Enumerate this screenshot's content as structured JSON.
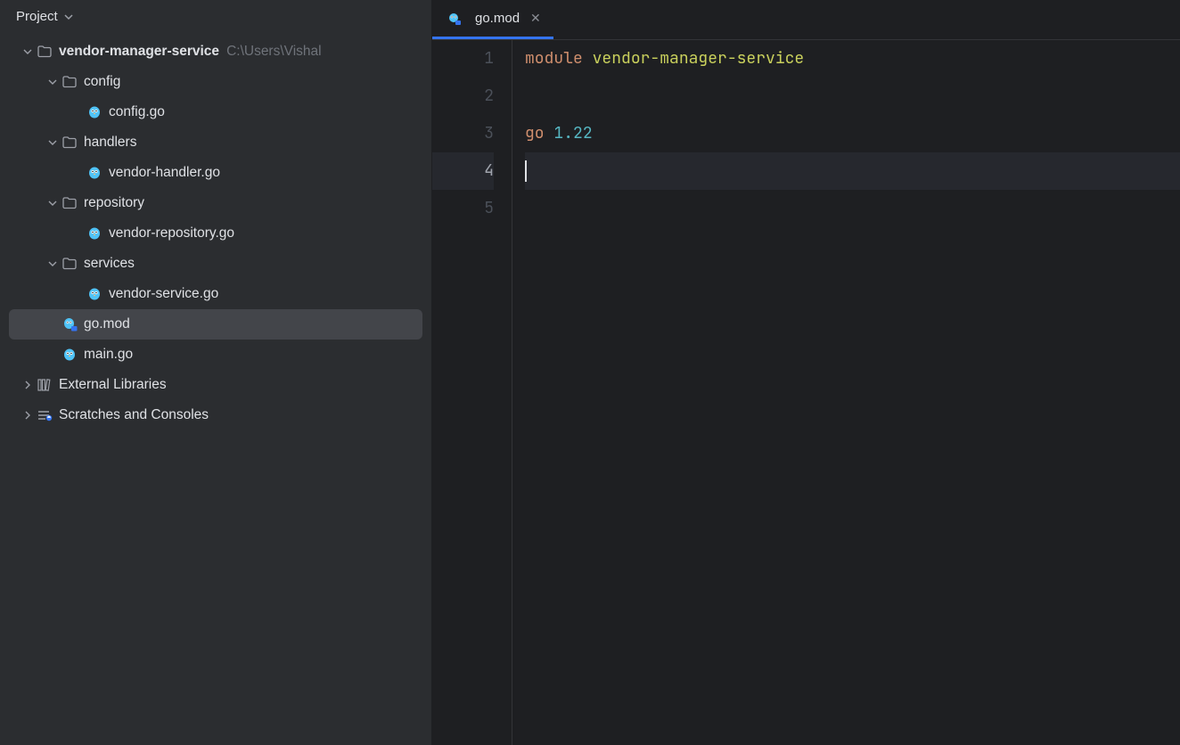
{
  "sidebar": {
    "title": "Project",
    "tree": [
      {
        "depth": 0,
        "arrow": "down",
        "icon": "folder",
        "label": "vendor-manager-service",
        "bold": true,
        "path": "C:\\Users\\Vishal"
      },
      {
        "depth": 1,
        "arrow": "down",
        "icon": "folder",
        "label": "config"
      },
      {
        "depth": 2,
        "arrow": "none",
        "icon": "gopher",
        "label": "config.go"
      },
      {
        "depth": 1,
        "arrow": "down",
        "icon": "folder",
        "label": "handlers"
      },
      {
        "depth": 2,
        "arrow": "none",
        "icon": "gopher",
        "label": "vendor-handler.go"
      },
      {
        "depth": 1,
        "arrow": "down",
        "icon": "folder",
        "label": "repository"
      },
      {
        "depth": 2,
        "arrow": "none",
        "icon": "gopher",
        "label": "vendor-repository.go"
      },
      {
        "depth": 1,
        "arrow": "down",
        "icon": "folder",
        "label": "services"
      },
      {
        "depth": 2,
        "arrow": "none",
        "icon": "gopher",
        "label": "vendor-service.go"
      },
      {
        "depth": 1,
        "arrow": "none",
        "icon": "gopher-mod",
        "label": "go.mod",
        "selected": true
      },
      {
        "depth": 1,
        "arrow": "none",
        "icon": "gopher",
        "label": "main.go"
      },
      {
        "depth": 0,
        "arrow": "right",
        "icon": "library",
        "label": "External Libraries"
      },
      {
        "depth": 0,
        "arrow": "right",
        "icon": "scratch",
        "label": "Scratches and Consoles"
      }
    ]
  },
  "editor": {
    "tab": {
      "label": "go.mod",
      "icon": "gopher-mod"
    },
    "lines": [
      "1",
      "2",
      "3",
      "4",
      "5"
    ],
    "currentLine": 4,
    "code": {
      "moduleKeyword": "module",
      "moduleName": "vendor-manager-service",
      "goKeyword": "go",
      "goVersion": "1.22"
    }
  }
}
